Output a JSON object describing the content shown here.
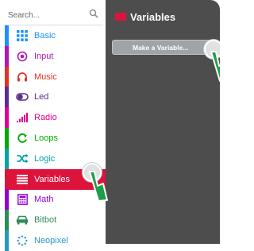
{
  "search": {
    "placeholder": "Search...",
    "icon": "search-icon"
  },
  "categories": [
    {
      "label": "Basic",
      "color": "#1e90ff",
      "icon": "grid-icon"
    },
    {
      "label": "Input",
      "color": "#b118b1",
      "icon": "target-icon"
    },
    {
      "label": "Music",
      "color": "#e63022",
      "icon": "headphones-icon"
    },
    {
      "label": "Led",
      "color": "#5c2d91",
      "icon": "toggle-icon"
    },
    {
      "label": "Radio",
      "color": "#e3008c",
      "icon": "signal-bars-icon"
    },
    {
      "label": "Loops",
      "color": "#00aa00",
      "icon": "refresh-icon"
    },
    {
      "label": "Logic",
      "color": "#00a4a6",
      "icon": "shuffle-icon"
    },
    {
      "label": "Variables",
      "color": "#dc143c",
      "icon": "list-icon",
      "selected": true
    },
    {
      "label": "Math",
      "color": "#9400d3",
      "icon": "calculator-icon"
    },
    {
      "label": "Bitbot",
      "color": "#2e8b57",
      "icon": "car-icon"
    },
    {
      "label": "Neopixel",
      "color": "#2699bf",
      "icon": "dots-circle-icon"
    }
  ],
  "flyout": {
    "title": "Variables",
    "title_color": "#dc143c",
    "make_variable_label": "Make a Variable...",
    "background": "#4d4d4d"
  }
}
